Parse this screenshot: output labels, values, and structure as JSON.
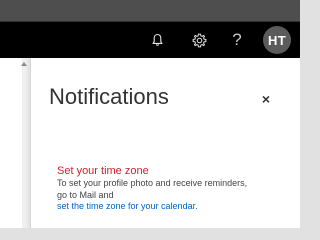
{
  "header": {
    "icons": {
      "notifications": "bell-icon",
      "settings": "gear-icon",
      "help": "help-icon"
    },
    "help_glyph": "?",
    "avatar_initials": "HT"
  },
  "notifications_panel": {
    "title": "Notifications",
    "close_glyph": "×",
    "items": [
      {
        "title": "Set your time zone",
        "body_line1": "To set your profile photo and receive reminders,",
        "body_line2": "go to Mail and",
        "link": "set the time zone for your calendar."
      }
    ]
  },
  "colors": {
    "header_bg": "#000000",
    "top_strip": "#4e4e4e",
    "notice_title": "#c4262e",
    "link": "#0064c1",
    "avatar_bg": "#5b5b5b"
  }
}
